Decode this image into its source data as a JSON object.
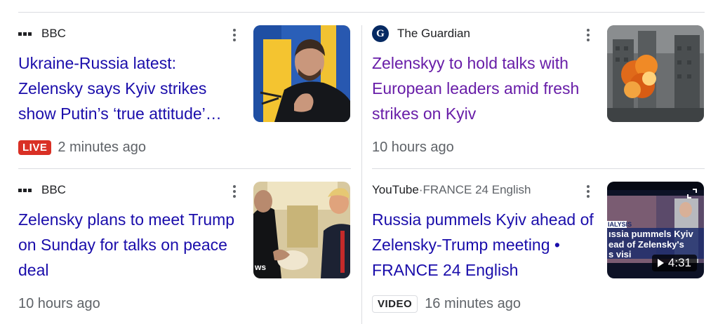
{
  "cards": [
    {
      "source": "BBC",
      "source_icon": "bbc-logo",
      "headline": "Ukraine-Russia latest: Zelensky says Kyiv strikes show Putin’s ‘true attitude’…",
      "badge": "LIVE",
      "time": "2 minutes ago",
      "thumbnail": "zelensky-speaking-photo"
    },
    {
      "source": "The Guardian",
      "source_icon": "guardian-logo",
      "source_icon_letter": "G",
      "headline": "Zelenskyy to hold talks with European leaders amid fresh strikes on Kyiv",
      "time": "10 hours ago",
      "thumbnail": "explosion-building-photo"
    },
    {
      "source": "BBC",
      "source_icon": "bbc-logo",
      "headline": "Zelensky plans to meet Trump on Sunday for talks on peace deal",
      "time": "10 hours ago",
      "thumbnail": "zelensky-trump-meeting-photo",
      "thumb_caption": "ws"
    },
    {
      "source": "YouTube",
      "source_sep": " · ",
      "channel": "FRANCE 24 English",
      "headline": "Russia pummels Kyiv ahead of Zelensky-Trump meeting • FRANCE 24 English",
      "badge": "VIDEO",
      "time": "16 minutes ago",
      "thumbnail": "france24-video-still",
      "thumb_overlay": {
        "tag": "IALYSIS",
        "line1": "ıssia pummels Kyiv",
        "line2": "ead of Zelensky's",
        "line3": "s visi"
      },
      "duration": "4:31"
    }
  ],
  "colors": {
    "headline_link": "#1a0dab",
    "headline_visited": "#681da8",
    "meta_text": "#5f6368",
    "live_red": "#d93025",
    "divider": "#dadce0"
  }
}
